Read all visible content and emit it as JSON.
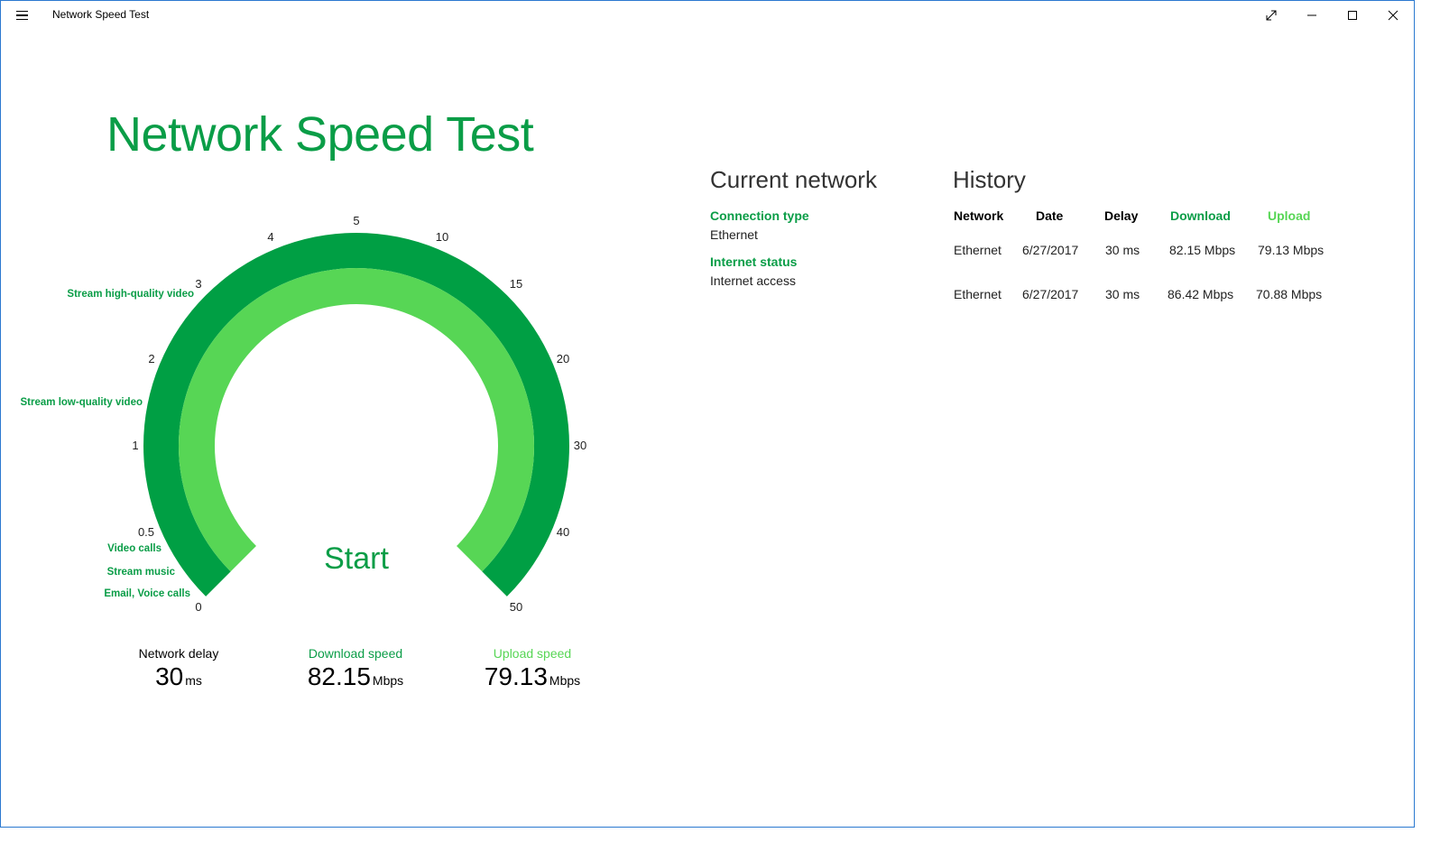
{
  "app": {
    "title": "Network Speed Test"
  },
  "hero": {
    "title": "Network Speed Test"
  },
  "gauge": {
    "start_label": "Start",
    "tick_labels": [
      "0",
      "0.5",
      "1",
      "2",
      "3",
      "4",
      "5",
      "10",
      "15",
      "20",
      "30",
      "40",
      "50"
    ],
    "thresholds": [
      "Email, Voice calls",
      "Stream music",
      "Video calls",
      "Stream low-quality video",
      "Stream high-quality video"
    ],
    "colors": {
      "outer": "#009f44",
      "inner": "#57d655",
      "accent": "#0a9d47"
    }
  },
  "metrics": {
    "delay": {
      "label": "Network delay",
      "value": "30",
      "unit": "ms"
    },
    "download": {
      "label": "Download speed",
      "value": "82.15",
      "unit": "Mbps"
    },
    "upload": {
      "label": "Upload speed",
      "value": "79.13",
      "unit": "Mbps"
    }
  },
  "current_network": {
    "title": "Current network",
    "connection_type_label": "Connection type",
    "connection_type": "Ethernet",
    "internet_status_label": "Internet status",
    "internet_status": "Internet access"
  },
  "history": {
    "title": "History",
    "headers": [
      "Network",
      "Date",
      "Delay",
      "Download",
      "Upload"
    ],
    "rows": [
      [
        "Ethernet",
        "6/27/2017",
        "30 ms",
        "82.15 Mbps",
        "79.13 Mbps"
      ],
      [
        "Ethernet",
        "6/27/2017",
        "30 ms",
        "86.42 Mbps",
        "70.88 Mbps"
      ]
    ]
  }
}
